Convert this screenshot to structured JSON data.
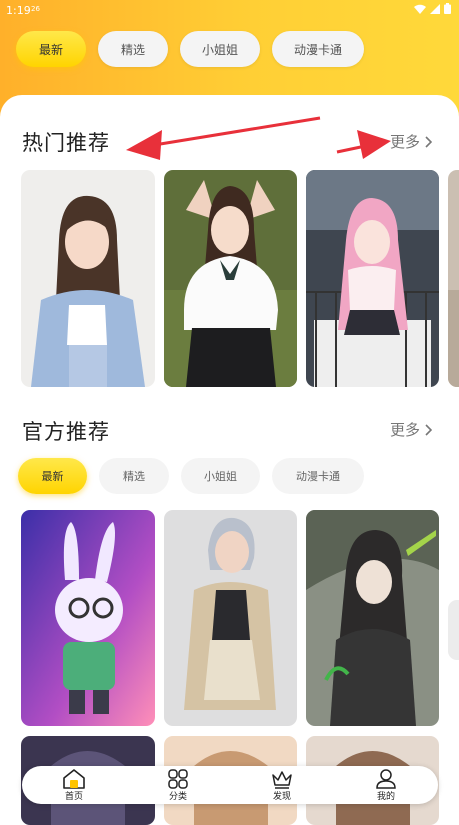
{
  "status_bar": {
    "time": "1:19",
    "extra": "26"
  },
  "top_tabs": [
    {
      "label": "最新",
      "active": true
    },
    {
      "label": "精选",
      "active": false
    },
    {
      "label": "小姐姐",
      "active": false
    },
    {
      "label": "动漫卡通",
      "active": false
    }
  ],
  "hot": {
    "title": "热门推荐",
    "more": "更多"
  },
  "official": {
    "title": "官方推荐",
    "more": "更多"
  },
  "sub_tabs": [
    {
      "label": "最新",
      "active": true
    },
    {
      "label": "精选",
      "active": false
    },
    {
      "label": "小姐姐",
      "active": false
    },
    {
      "label": "动漫卡通",
      "active": false
    }
  ],
  "bottom_nav": [
    {
      "label": "首页",
      "icon": "home-icon"
    },
    {
      "label": "分类",
      "icon": "grid-icon"
    },
    {
      "label": "发现",
      "icon": "crown-icon"
    },
    {
      "label": "我的",
      "icon": "user-icon"
    }
  ],
  "colors": {
    "accent": "#ffd400",
    "header": "#ffc02e",
    "annotation_arrow": "#e8303a"
  }
}
